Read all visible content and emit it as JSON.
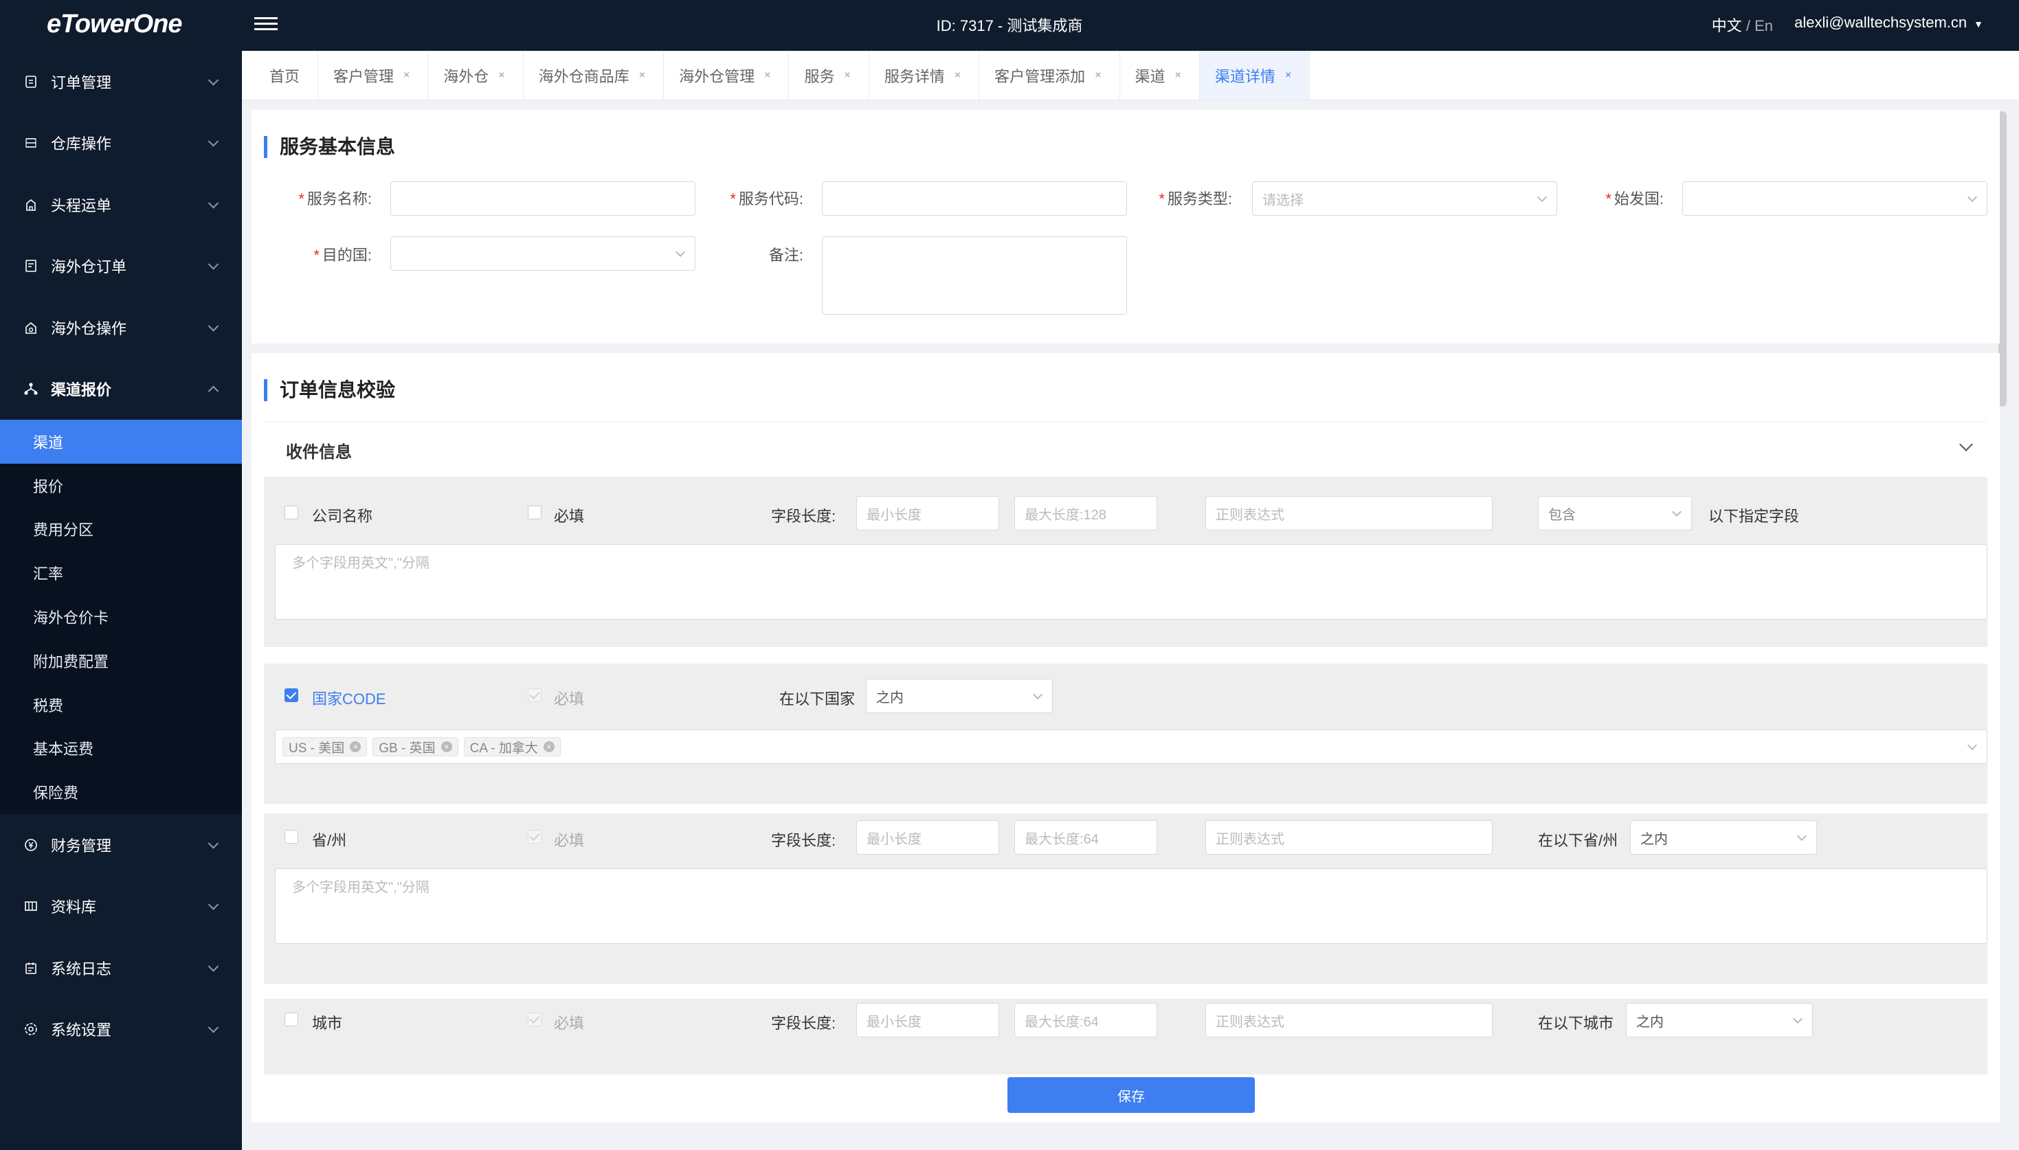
{
  "header": {
    "logo": "eTowerOne",
    "center_title": "ID: 7317 - 测试集成商",
    "lang_zh": "中文",
    "lang_sep": " / ",
    "lang_en": "En",
    "user_email": "alexli@walltechsystem.cn"
  },
  "sidebar": {
    "items": [
      {
        "label": "订单管理",
        "icon": "order-icon"
      },
      {
        "label": "仓库操作",
        "icon": "warehouse-icon"
      },
      {
        "label": "头程运单",
        "icon": "shipment-icon"
      },
      {
        "label": "海外仓订单",
        "icon": "overseas-order-icon"
      },
      {
        "label": "海外仓操作",
        "icon": "overseas-operation-icon"
      },
      {
        "label": "渠道报价",
        "icon": "channel-icon"
      }
    ],
    "subitems": [
      "渠道",
      "报价",
      "费用分区",
      "汇率",
      "海外仓价卡",
      "附加费配置",
      "税费",
      "基本运费",
      "保险费"
    ],
    "items_after": [
      {
        "label": "财务管理",
        "icon": "finance-icon"
      },
      {
        "label": "资料库",
        "icon": "database-icon"
      },
      {
        "label": "系统日志",
        "icon": "log-icon"
      },
      {
        "label": "系统设置",
        "icon": "settings-icon"
      }
    ]
  },
  "tabs": [
    {
      "label": "首页",
      "closable": false
    },
    {
      "label": "客户管理",
      "closable": true
    },
    {
      "label": "海外仓",
      "closable": true
    },
    {
      "label": "海外仓商品库",
      "closable": true
    },
    {
      "label": "海外仓管理",
      "closable": true
    },
    {
      "label": "服务",
      "closable": true
    },
    {
      "label": "服务详情",
      "closable": true
    },
    {
      "label": "客户管理添加",
      "closable": true
    },
    {
      "label": "渠道",
      "closable": true
    },
    {
      "label": "渠道详情",
      "closable": true,
      "active": true
    }
  ],
  "basic": {
    "title": "服务基本信息",
    "service_name": "服务名称:",
    "service_code": "服务代码:",
    "service_type": "服务类型:",
    "service_type_placeholder": "请选择",
    "origin_country": "始发国:",
    "dest_country": "目的国:",
    "remark": "备注:"
  },
  "validation": {
    "title": "订单信息校验",
    "receiver_title": "收件信息",
    "company": {
      "label": "公司名称",
      "required": "必填",
      "length_label": "字段长度:",
      "min_placeholder": "最小长度",
      "max_placeholder": "最大长度:128",
      "regex_placeholder": "正则表达式",
      "mode": "包含",
      "suffix": "以下指定字段",
      "textarea_placeholder": "多个字段用英文\",\"分隔"
    },
    "country": {
      "label": "国家CODE",
      "required": "必填",
      "in_label": "在以下国家",
      "mode": "之内",
      "tags": [
        "US - 美国",
        "GB - 英国",
        "CA - 加拿大"
      ]
    },
    "province": {
      "label": "省/州",
      "required": "必填",
      "length_label": "字段长度:",
      "min_placeholder": "最小长度",
      "max_placeholder": "最大长度:64",
      "regex_placeholder": "正则表达式",
      "in_label": "在以下省/州",
      "mode": "之内",
      "textarea_placeholder": "多个字段用英文\",\"分隔"
    },
    "city": {
      "label": "城市",
      "required": "必填",
      "length_label": "字段长度:",
      "min_placeholder": "最小长度",
      "max_placeholder": "最大长度:64",
      "regex_placeholder": "正则表达式",
      "in_label": "在以下城市",
      "mode": "之内"
    }
  },
  "footer": {
    "save_label": "保存"
  },
  "colors": {
    "accent": "#3d7ef0",
    "sidebar_bg": "#0f1c2e",
    "required": "#f5222d"
  }
}
